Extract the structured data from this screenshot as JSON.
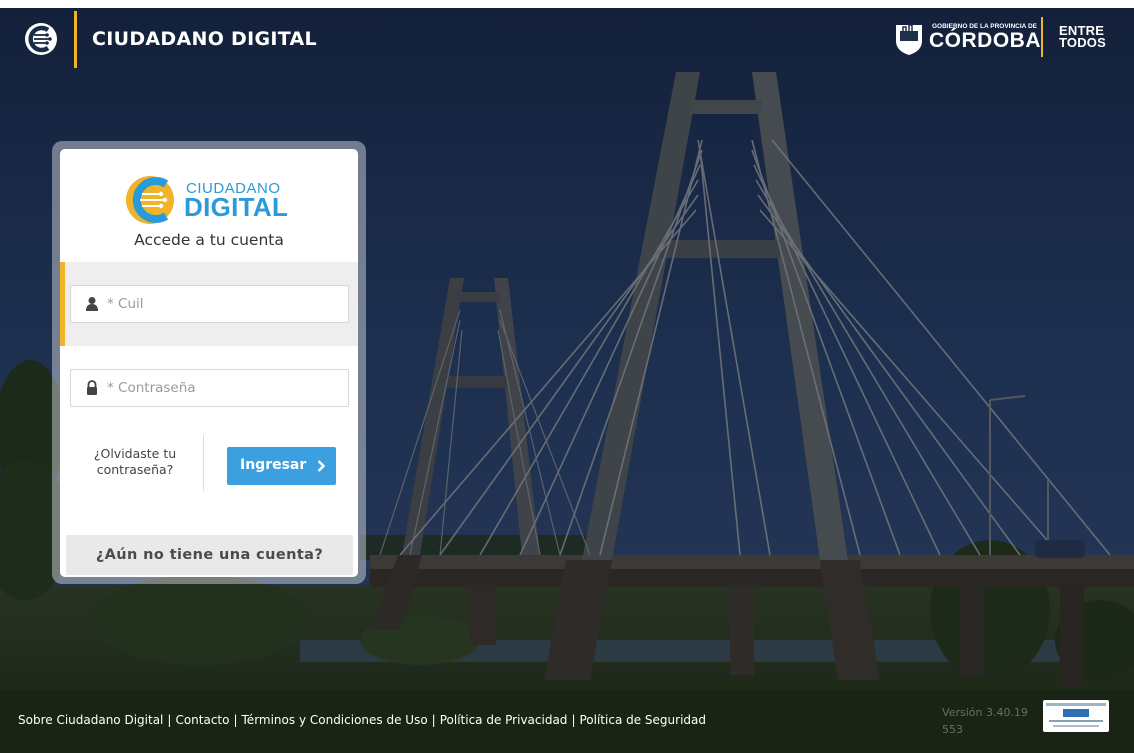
{
  "header": {
    "title": "CIUDADANO DIGITAL",
    "gov_small": "GOBIERNO DE LA PROVINCIA DE",
    "gov_big": "CÓRDOBA",
    "entre_l1": "ENTRE",
    "entre_l2": "TODOS"
  },
  "login": {
    "brand_l1": "CIUDADANO",
    "brand_l2": "DIGITAL",
    "subtitle": "Accede a tu cuenta",
    "cuil_placeholder": "* Cuil",
    "password_placeholder": "* Contraseña",
    "forgot_l1": "¿Olvidaste tu",
    "forgot_l2": "contraseña?",
    "submit_label": "Ingresar",
    "signup_label": "¿Aún no tiene una cuenta?"
  },
  "footer": {
    "links": [
      "Sobre Ciudadano Digital",
      "Contacto",
      "Términos y Condiciones de Uso",
      "Política de Privacidad",
      "Política de Seguridad"
    ],
    "separator": "|",
    "version": "Versión 3.40.19",
    "build": "553"
  },
  "colors": {
    "accent": "#f0b429",
    "primary": "#3b9fe0",
    "brand_blue": "#2b9ad9"
  },
  "icons": [
    "ciudadano-digital-logo",
    "cordoba-shield-icon",
    "user-icon",
    "lock-icon",
    "chevron-right-icon",
    "pdp-badge"
  ]
}
